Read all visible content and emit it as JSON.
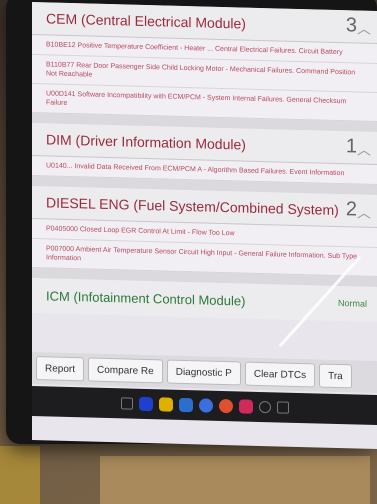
{
  "sections": [
    {
      "title": "CEM (Central Electrical Module)",
      "count": "3",
      "dtcs": [
        "B10BE12 Positive Temperature Coefficient - Heater ... Central Electrical Failures. Circuit Battery",
        "B110B77 Rear Door Passenger Side Child Locking Motor - Mechanical Failures. Command Position Not Reachable",
        "U00D141 Software Incompatibility with ECM/PCM - System Internal Failures. General Checksum Failure"
      ]
    },
    {
      "title": "DIM (Driver Information Module)",
      "count": "1",
      "dtcs": [
        "U0140... Invalid Data Received From ECM/PCM A - Algorithm Based Failures. Event Information"
      ]
    },
    {
      "title": "DIESEL ENG (Fuel System/Combined System)",
      "count": "2",
      "dtcs": [
        "P0405000 Closed Loop EGR Control At Limit - Flow Too Low",
        "P007000 Ambient Air Temperature Sensor Circuit High Input - General Failure Information. Sub Type Information"
      ]
    }
  ],
  "icm": {
    "title": "ICM (Infotainment Control Module)",
    "status": "Normal"
  },
  "toolbar": {
    "report": "Report",
    "compare": "Compare Re",
    "diagnostic": "Diagnostic P",
    "clear": "Clear DTCs",
    "trace": "Tra"
  },
  "nav_icons": [
    "blue",
    "#e0b000",
    "#2a6fd0",
    "#3b6fe0",
    "#e05030",
    "#d02a5a"
  ]
}
